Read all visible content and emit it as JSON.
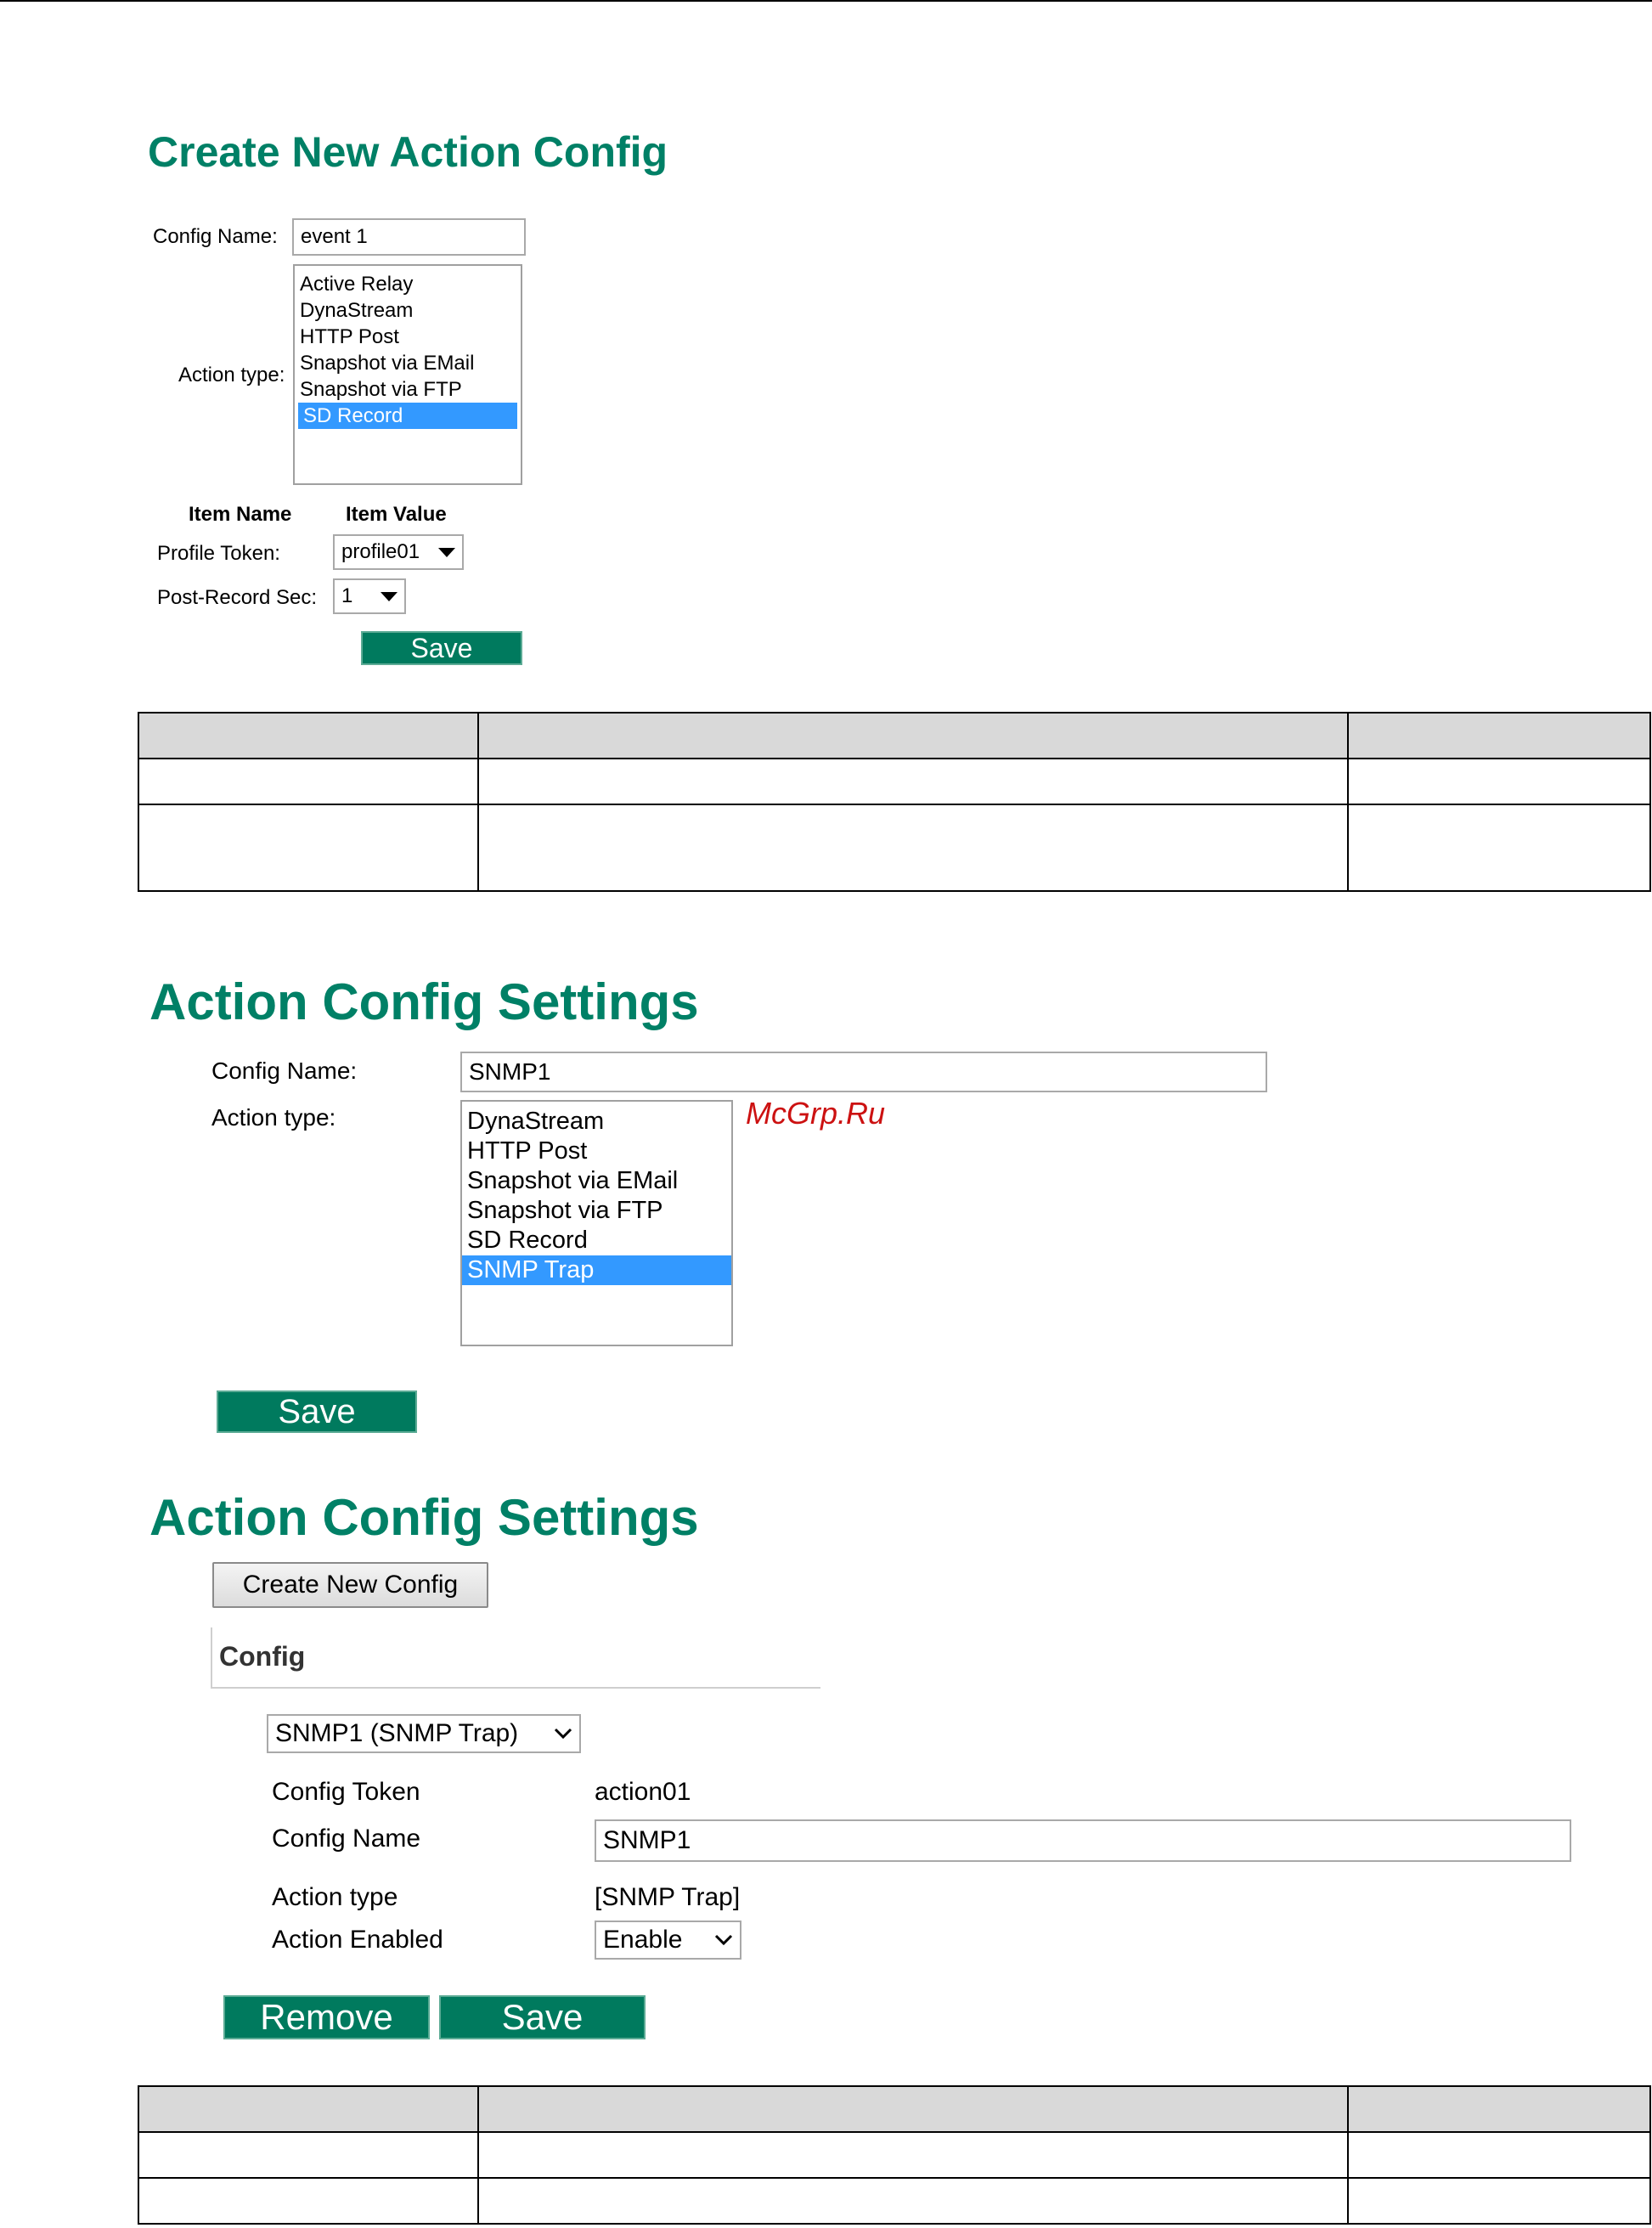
{
  "section1": {
    "title": "Create New Action Config",
    "config_name_label": "Config Name:",
    "config_name_value": "event 1",
    "action_type_label": "Action type:",
    "action_types": [
      "Active Relay",
      "DynaStream",
      "HTTP Post",
      "Snapshot via EMail",
      "Snapshot via FTP",
      "SD Record"
    ],
    "selected_action_type": "SD Record",
    "item_name_header": "Item Name",
    "item_value_header": "Item Value",
    "profile_token_label": "Profile Token:",
    "profile_token_value": "profile01",
    "post_record_label": "Post-Record Sec:",
    "post_record_value": "1",
    "save_label": "Save"
  },
  "table1": {
    "rows": [
      [
        "",
        "",
        ""
      ],
      [
        "",
        "",
        ""
      ],
      [
        "",
        "",
        ""
      ]
    ]
  },
  "section2": {
    "title": "Action Config Settings",
    "config_name_label": "Config Name:",
    "config_name_value": "SNMP1",
    "action_type_label": "Action type:",
    "action_types": [
      "DynaStream",
      "HTTP Post",
      "Snapshot via EMail",
      "Snapshot via FTP",
      "SD Record",
      "SNMP Trap"
    ],
    "selected_action_type": "SNMP Trap",
    "save_label": "Save"
  },
  "watermark": "McGrp.Ru",
  "section3": {
    "title": "Action Config Settings",
    "create_button_label": "Create New Config",
    "config_heading": "Config",
    "config_select_value": "SNMP1 (SNMP Trap)",
    "config_token_label": "Config Token",
    "config_token_value": "action01",
    "config_name_label": "Config Name",
    "config_name_value": "SNMP1",
    "action_type_label": "Action type",
    "action_type_value": "[SNMP Trap]",
    "action_enabled_label": "Action Enabled",
    "action_enabled_value": "Enable",
    "remove_label": "Remove",
    "save_label": "Save"
  },
  "table2": {
    "rows": [
      [
        "",
        "",
        ""
      ],
      [
        "",
        "",
        ""
      ],
      [
        "",
        "",
        ""
      ]
    ]
  },
  "colors": {
    "title_green": "#008066",
    "button_green": "#007a5e",
    "selection_blue": "#3399ff",
    "table_header": "#d9d9d9"
  }
}
